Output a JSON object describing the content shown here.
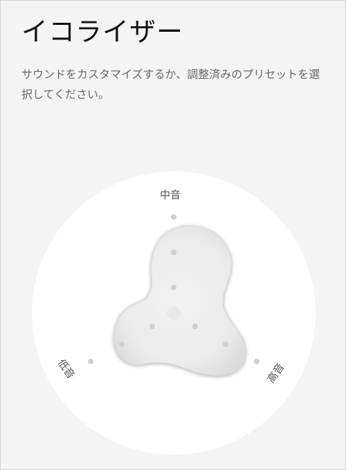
{
  "header": {
    "title": "イコライザー",
    "description": "サウンドをカスタマイズするか、調整済みのプリセットを選択してください。"
  },
  "equalizer": {
    "bands": {
      "mid": "中音",
      "low": "低音",
      "high": "高音"
    },
    "colors": {
      "background": "#f4f4f4",
      "dial": "#ffffff",
      "blob": "#ececec",
      "dot": "#cfcfcf"
    }
  }
}
